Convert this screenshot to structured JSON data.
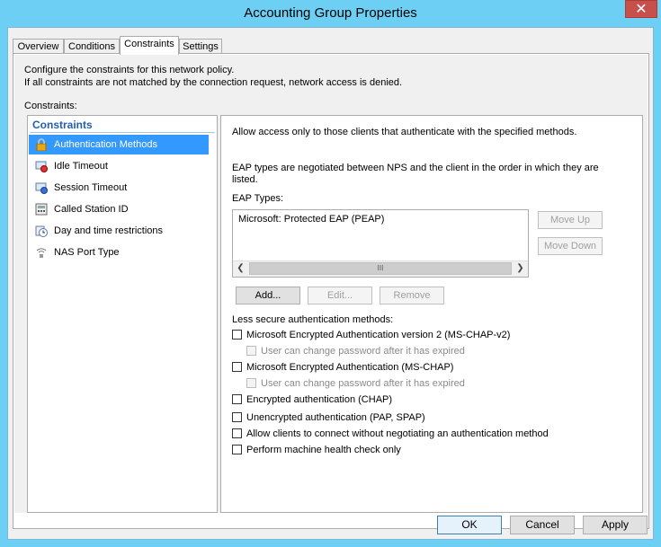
{
  "window": {
    "title": "Accounting Group Properties",
    "close_glyph": "✕"
  },
  "tabs": [
    {
      "label": "Overview"
    },
    {
      "label": "Conditions"
    },
    {
      "label": "Constraints",
      "active": true
    },
    {
      "label": "Settings"
    }
  ],
  "description": {
    "line1": "Configure the constraints for this network policy.",
    "line2": "If all constraints are not matched by the connection request, network access is denied."
  },
  "constraints_label": "Constraints:",
  "constraints_list": {
    "header": "Constraints",
    "items": [
      {
        "label": "Authentication Methods",
        "icon": "lock-icon",
        "selected": true
      },
      {
        "label": "Idle Timeout",
        "icon": "idle-timeout-icon"
      },
      {
        "label": "Session Timeout",
        "icon": "session-timeout-icon"
      },
      {
        "label": "Called Station ID",
        "icon": "called-station-icon"
      },
      {
        "label": "Day and time restrictions",
        "icon": "clock-icon"
      },
      {
        "label": "NAS Port Type",
        "icon": "nas-port-icon"
      }
    ]
  },
  "auth": {
    "intro": "Allow access only to those clients that authenticate with the specified methods.",
    "eap_note": "EAP types are negotiated between NPS and the client in the order in which they are listed.",
    "eap_types_label": "EAP Types:",
    "eap_types": [
      "Microsoft: Protected EAP (PEAP)"
    ],
    "scroll_thumb_glyph": "III",
    "move_up": "Move Up",
    "move_down": "Move Down",
    "add": "Add...",
    "edit": "Edit...",
    "remove": "Remove",
    "less_secure_label": "Less secure authentication methods:",
    "methods": [
      {
        "label": "Microsoft Encrypted Authentication version 2 (MS-CHAP-v2)",
        "checked": false
      },
      {
        "label": "User can change password after it has expired",
        "checked": false,
        "disabled": true
      },
      {
        "label": "Microsoft Encrypted Authentication (MS-CHAP)",
        "checked": false
      },
      {
        "label": "User can change password after it has expired",
        "checked": false,
        "disabled": true
      },
      {
        "label": "Encrypted authentication (CHAP)",
        "checked": false
      },
      {
        "label": "Unencrypted authentication (PAP, SPAP)",
        "checked": false
      },
      {
        "label": "Allow clients to connect without negotiating an authentication method",
        "checked": false
      },
      {
        "label": "Perform machine health check only",
        "checked": false
      }
    ]
  },
  "footer": {
    "ok": "OK",
    "cancel": "Cancel",
    "apply": "Apply"
  }
}
